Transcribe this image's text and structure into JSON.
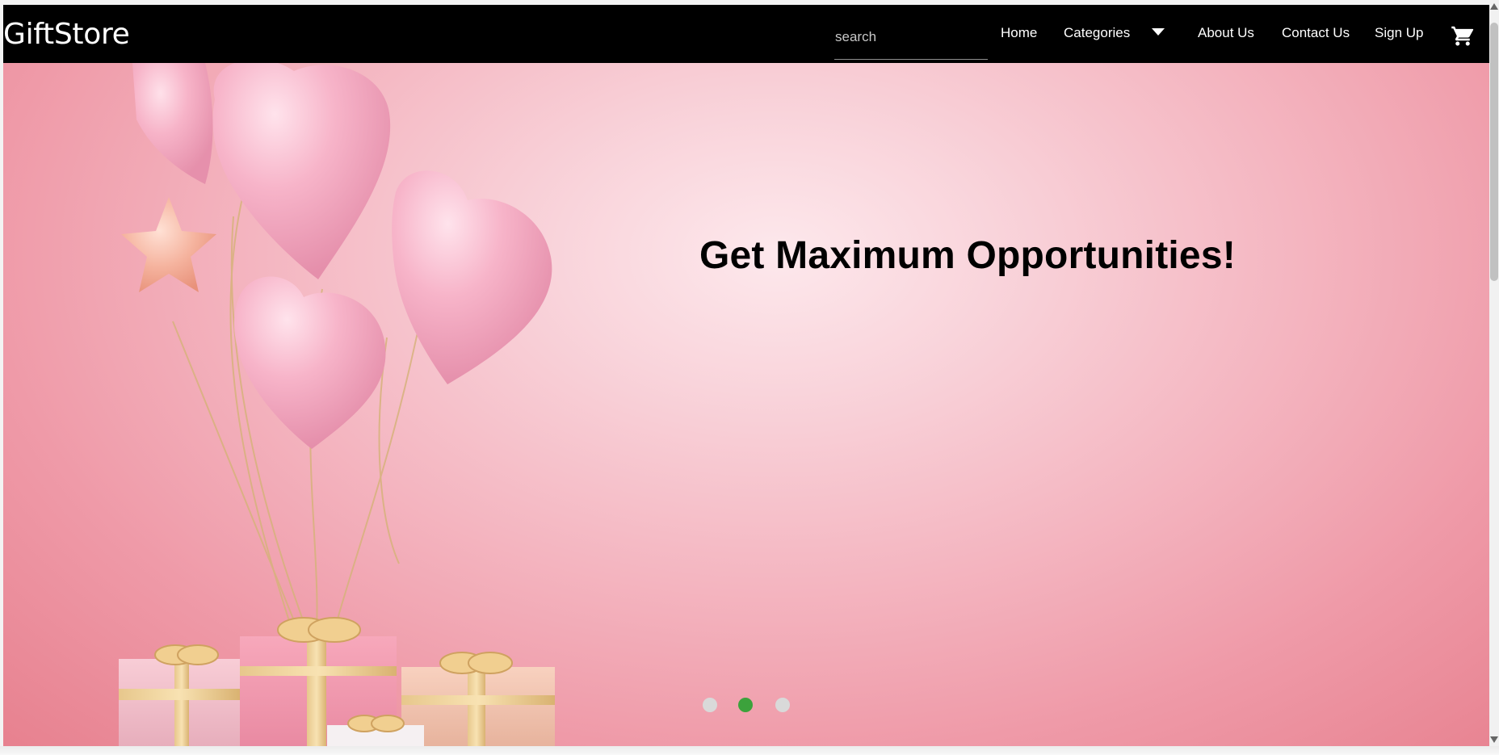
{
  "header": {
    "brand": "GiftStore",
    "search": {
      "placeholder": "search",
      "value": ""
    },
    "nav": {
      "home": "Home",
      "categories": "Categories",
      "about": "About Us",
      "contact": "Contact Us",
      "signup": "Sign Up"
    },
    "icons": {
      "categories": "chevron-down-icon",
      "cart": "shopping-cart-icon"
    }
  },
  "hero": {
    "title": "Get Maximum Opportunities!",
    "dots": [
      {
        "active": false
      },
      {
        "active": true
      },
      {
        "active": false
      }
    ]
  },
  "colors": {
    "nav_bg": "#000000",
    "nav_text": "#ffffff",
    "hero_pink": "#f4b5c0",
    "dot_active": "#3ca23c",
    "dot_inactive": "#d9d9d9"
  }
}
